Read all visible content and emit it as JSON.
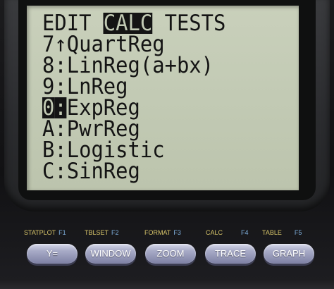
{
  "menu": {
    "tabs": [
      "EDIT",
      "CALC",
      "TESTS"
    ],
    "selected_tab": "CALC",
    "items": [
      {
        "key": "7",
        "sep": "↑",
        "label": "QuartReg"
      },
      {
        "key": "8",
        "sep": ":",
        "label": "LinReg(a+bx)"
      },
      {
        "key": "9",
        "sep": ":",
        "label": "LnReg"
      },
      {
        "key": "0",
        "sep": ":",
        "label": "ExpReg",
        "selected": true
      },
      {
        "key": "A",
        "sep": ":",
        "label": "PwrReg"
      },
      {
        "key": "B",
        "sep": ":",
        "label": "Logistic"
      },
      {
        "key": "C",
        "sep": ":",
        "label": "SinReg"
      }
    ]
  },
  "function_keys": [
    {
      "label": "Y=",
      "shift": "STATPLOT",
      "alpha": "F1"
    },
    {
      "label": "WINDOW",
      "shift": "TBLSET",
      "alpha": "F2"
    },
    {
      "label": "ZOOM",
      "shift": "FORMAT",
      "alpha": "F3"
    },
    {
      "label": "TRACE",
      "shift": "CALC",
      "alpha": "F4"
    },
    {
      "label": "GRAPH",
      "shift": "TABLE",
      "alpha": "F5"
    }
  ]
}
